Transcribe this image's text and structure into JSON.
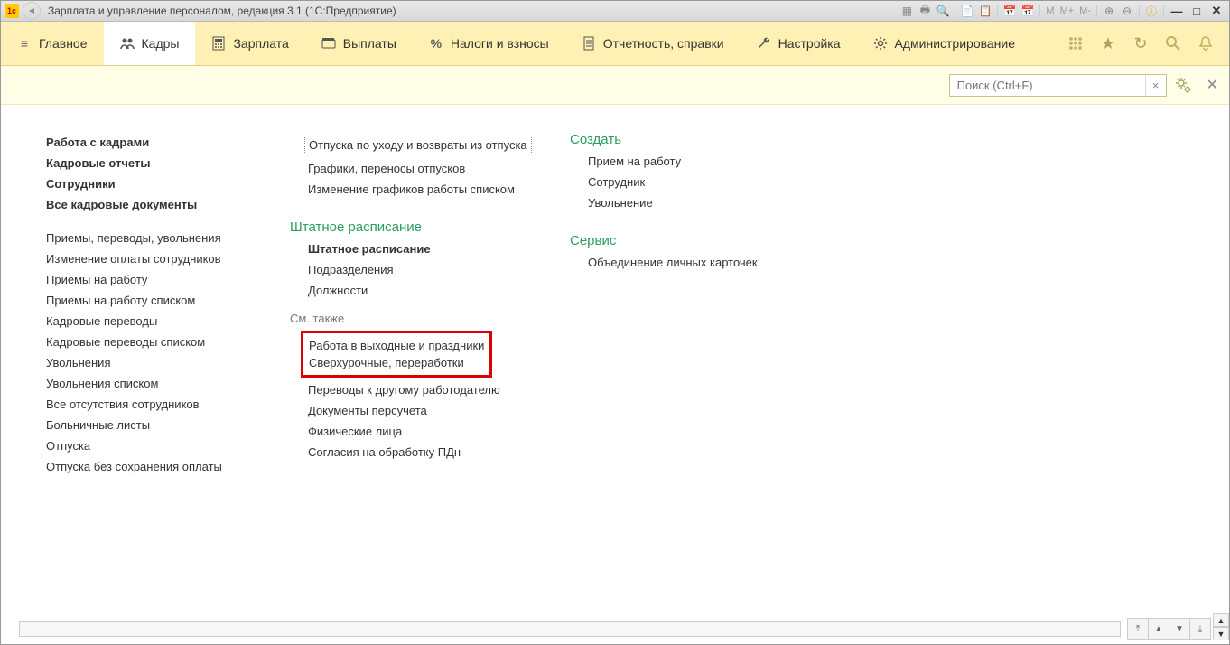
{
  "window": {
    "title": "Зарплата и управление персоналом, редакция 3.1  (1С:Предприятие)"
  },
  "titlebar_memory": {
    "m": "M",
    "mplus": "M+",
    "mminus": "M-"
  },
  "menu": {
    "main": "Главное",
    "kadry": "Кадры",
    "zarplata": "Зарплата",
    "vyplaty": "Выплаты",
    "nalogi": "Налоги и взносы",
    "otchet": "Отчетность, справки",
    "nastroyka": "Настройка",
    "admin": "Администрирование"
  },
  "search": {
    "placeholder": "Поиск (Ctrl+F)",
    "clear": "×"
  },
  "col1": {
    "rabota_s_kadrami": "Работа с кадрами",
    "kadrovye_otchety": "Кадровые отчеты",
    "sotrudniki": "Сотрудники",
    "vse_kadrovye": "Все кадровые документы",
    "priemy_perevody": "Приемы, переводы, увольнения",
    "izmenenie_oplaty": "Изменение оплаты сотрудников",
    "priemy_na_rabotu": "Приемы на работу",
    "priemy_spiskom": "Приемы на работу списком",
    "kadrovye_perevody": "Кадровые переводы",
    "kadrovye_perevody_spiskom": "Кадровые переводы списком",
    "uvolneniya": "Увольнения",
    "uvolneniya_spiskom": "Увольнения списком",
    "vse_otsut": "Все отсутствия сотрудников",
    "bolnichnye": "Больничные листы",
    "otpuska": "Отпуска",
    "otpuska_bez": "Отпуска без сохранения оплаты"
  },
  "col2": {
    "otpuska_po_uhodu": "Отпуска по уходу и возвраты из отпуска",
    "grafiki": "Графики, переносы отпусков",
    "izmenenie_grafikov": "Изменение графиков работы списком",
    "shtatnoe_head": "Штатное расписание",
    "shtatnoe": "Штатное расписание",
    "podrazdeleniya": "Подразделения",
    "dolzhnosti": "Должности",
    "sm_takzhe": "См. также",
    "rabota_vyh": "Работа в выходные и праздники",
    "sverhurochnye": "Сверхурочные, переработки",
    "perevody_drugomu": "Переводы к другому работодателю",
    "doc_persucheta": "Документы персучета",
    "fiz_litsa": "Физические лица",
    "soglasiya": "Согласия на обработку ПДн"
  },
  "col3": {
    "sozdat": "Создать",
    "priem": "Прием на работу",
    "sotrudnik": "Сотрудник",
    "uvolnenie": "Увольнение",
    "servis": "Сервис",
    "obedinenie": "Объединение личных карточек"
  }
}
